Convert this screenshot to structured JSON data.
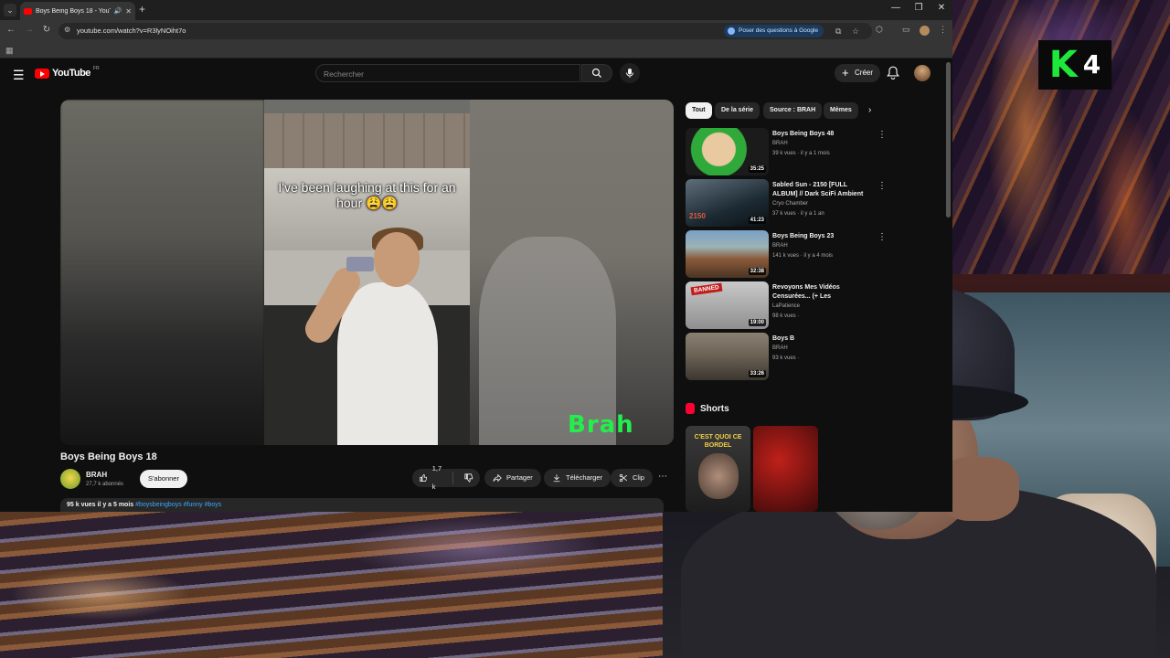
{
  "browser": {
    "tab_title": "Boys Being Boys 18 - YouTu",
    "url": "youtube.com/watch?v=R3lyNOiht7o",
    "ask_google": "Poser des questions à Google"
  },
  "youtube": {
    "logo_text": "YouTube",
    "region": "FR",
    "search_placeholder": "Rechercher",
    "create_label": "Créer"
  },
  "video": {
    "caption": "I've been laughing at this for an hour 😩😩",
    "watermark": "Brah",
    "title": "Boys Being Boys 18",
    "channel": "BRAH",
    "subscribers": "27,7 k abonnés",
    "subscribe_label": "S'abonner",
    "likes": "1,7 k",
    "share_label": "Partager",
    "download_label": "Télécharger",
    "clip_label": "Clip",
    "views": "95 k vues",
    "age": "il y a 5 mois",
    "hashtags": "#boysbeingboys #funny #boys"
  },
  "chips": [
    "Tout",
    "De la série",
    "Source : BRAH",
    "Mèmes"
  ],
  "recommendations": [
    {
      "title": "Boys Being Boys 48",
      "channel": "BRAH",
      "meta": "39 k vues · il y a 1 mois",
      "duration": "35:25"
    },
    {
      "title": "Sabled Sun - 2150 [FULL ALBUM] // Dark SciFi Ambient",
      "channel": "Cryo Chamber",
      "meta": "37 k vues · il y a 1 an",
      "duration": "41:23",
      "thumb_text": "2150"
    },
    {
      "title": "Boys Being Boys 23",
      "channel": "BRAH",
      "meta": "141 k vues · il y a 4 mois",
      "duration": "32:38"
    },
    {
      "title": "Revoyons Mes Vidéos Censurées... (+ Les",
      "channel": "LaPatience",
      "meta": "98 k vues ·",
      "duration": "19:00",
      "thumb_text": "BANNED"
    },
    {
      "title": "Boys B",
      "channel": "BRAH",
      "meta": "93 k vues ·",
      "duration": "33:26"
    }
  ],
  "shorts": {
    "label": "Shorts",
    "items": [
      {
        "text": "C'EST QUOI CE BORDEL"
      }
    ]
  },
  "overlay": {
    "badge_letter": "K",
    "badge_number": "4"
  },
  "colors": {
    "youtube_red": "#ff0000",
    "watermark_green": "#22f04a",
    "badge_green": "#1ee83a"
  }
}
